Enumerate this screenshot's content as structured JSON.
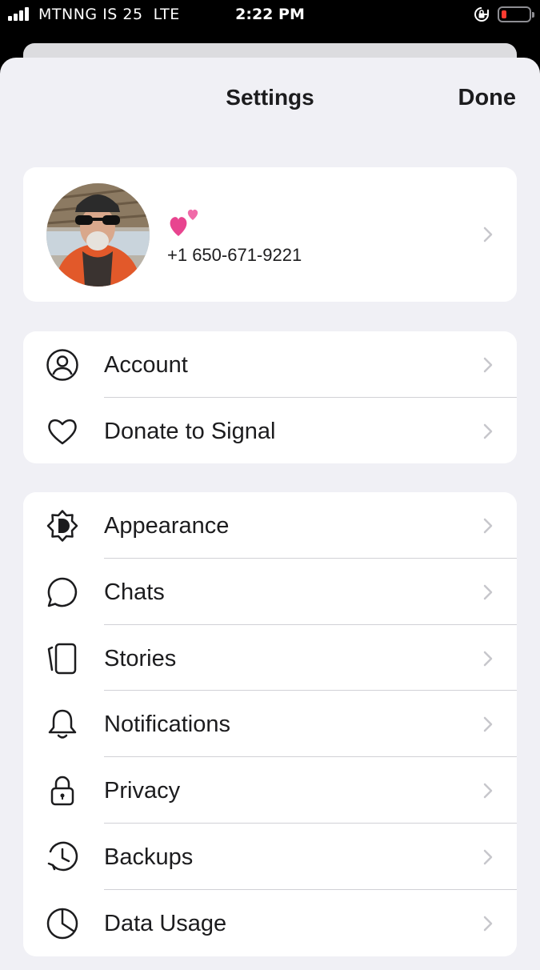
{
  "status_bar": {
    "carrier": "MTNNG IS 25",
    "network": "LTE",
    "time": "2:22 PM",
    "battery_color": "#ff3b30"
  },
  "header": {
    "title": "Settings",
    "done_label": "Done"
  },
  "profile": {
    "name_emoji_icon": "two-hearts-icon",
    "phone": "+1 650-671-9221"
  },
  "group1": [
    {
      "label": "Account",
      "icon": "person-circle-icon"
    },
    {
      "label": "Donate to Signal",
      "icon": "heart-icon"
    }
  ],
  "group2": [
    {
      "label": "Appearance",
      "icon": "appearance-icon"
    },
    {
      "label": "Chats",
      "icon": "chat-bubble-icon"
    },
    {
      "label": "Stories",
      "icon": "stories-icon"
    },
    {
      "label": "Notifications",
      "icon": "bell-icon"
    },
    {
      "label": "Privacy",
      "icon": "lock-icon"
    },
    {
      "label": "Backups",
      "icon": "backup-clock-icon"
    },
    {
      "label": "Data Usage",
      "icon": "pie-chart-icon"
    }
  ]
}
